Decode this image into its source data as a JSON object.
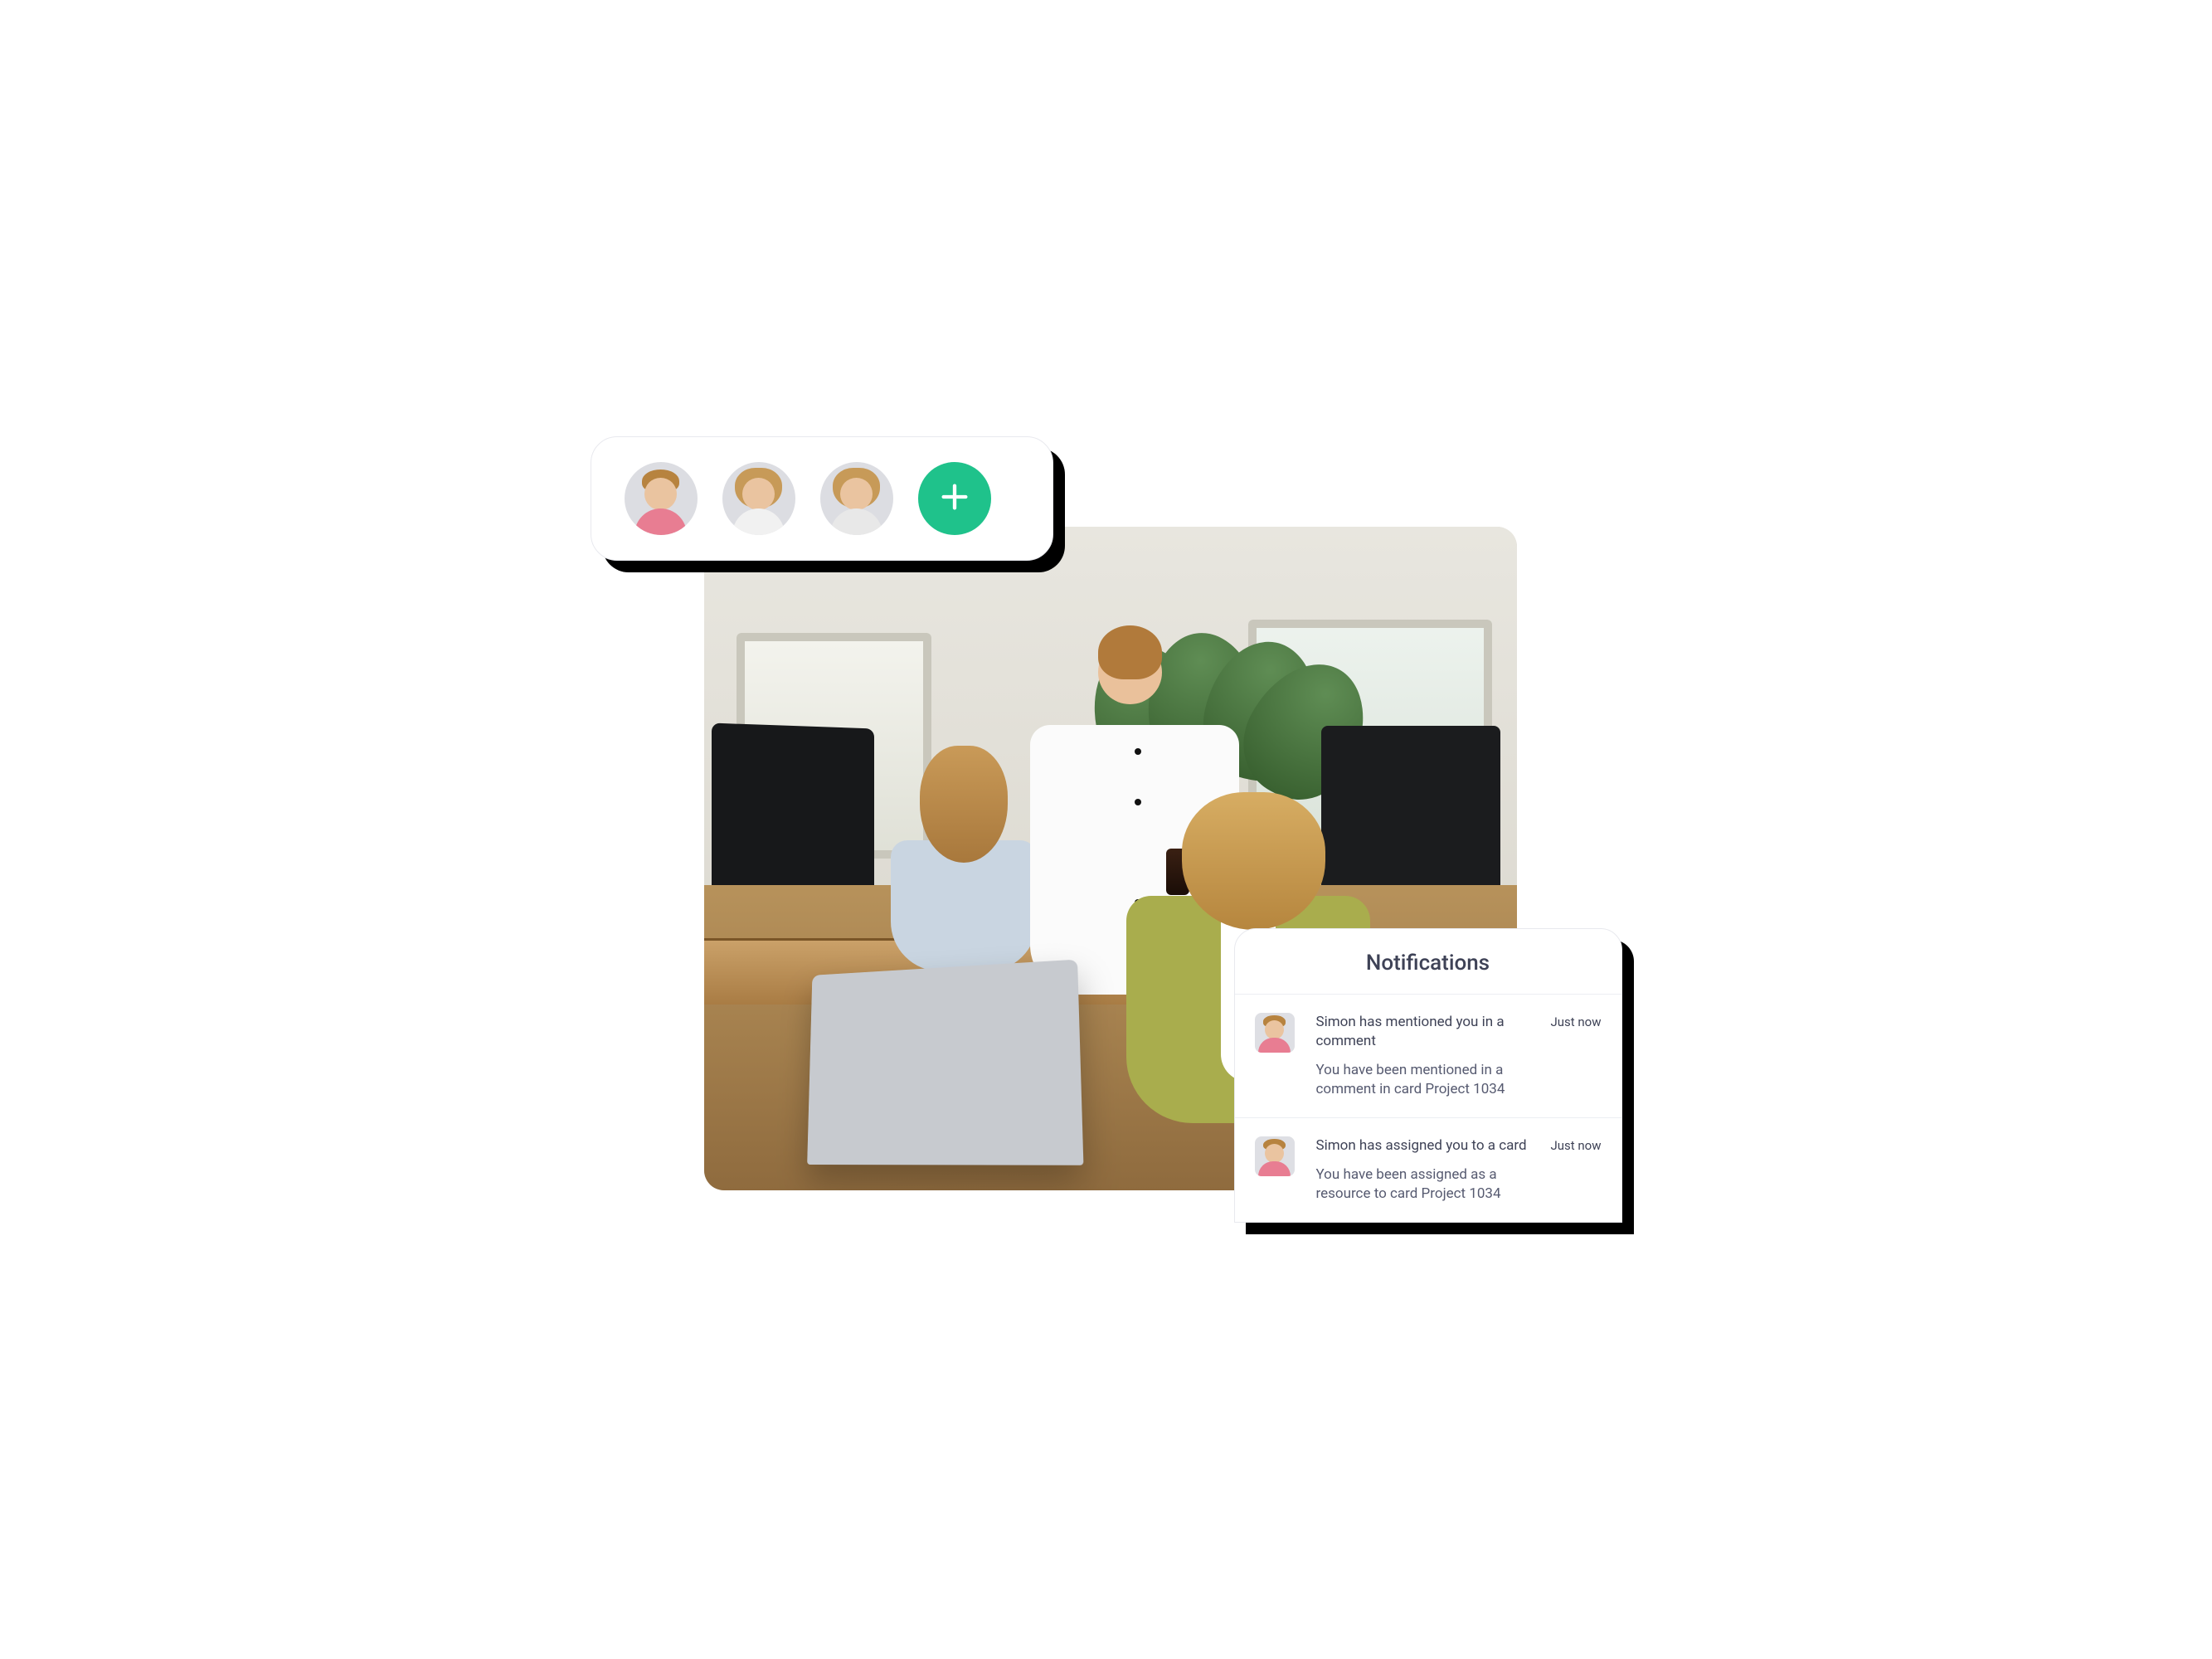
{
  "avatars": {
    "items": [
      {
        "name": "avatar-1"
      },
      {
        "name": "avatar-2"
      },
      {
        "name": "avatar-3"
      }
    ],
    "add_label": "+"
  },
  "notifications": {
    "title": "Notifications",
    "items": [
      {
        "title": "Simon has mentioned you in a comment",
        "body": "You have been mentioned in a comment in card Project 1034",
        "time": "Just now"
      },
      {
        "title": "Simon has assigned you to a card",
        "body": "You have been assigned as a resource to card Project 1034",
        "time": "Just now"
      }
    ]
  },
  "colors": {
    "accent": "#1fc28b",
    "shadow": "#000000",
    "text": "#3e4256"
  }
}
